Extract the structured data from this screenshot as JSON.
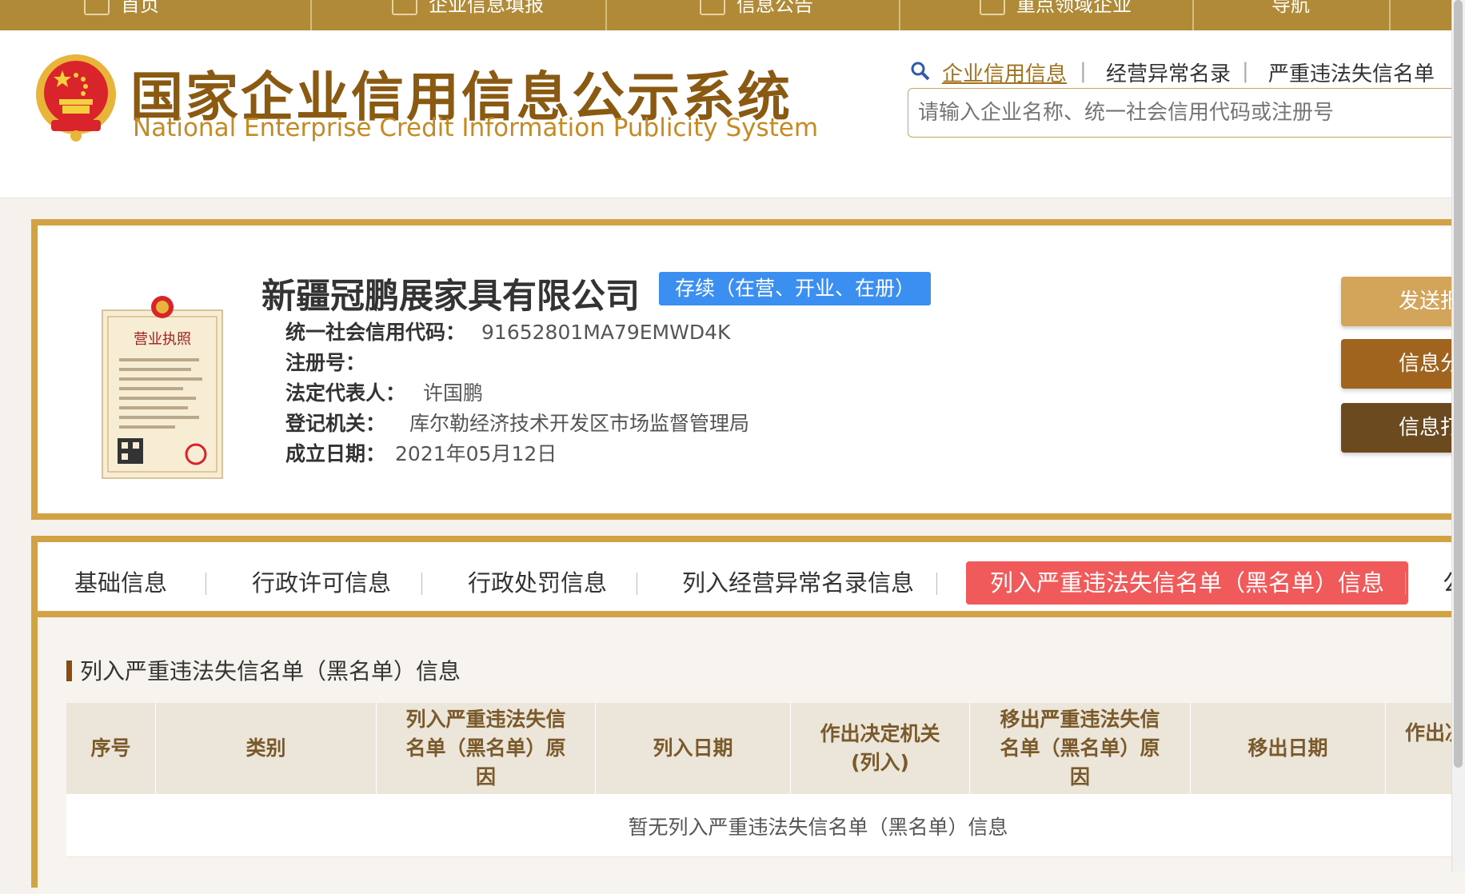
{
  "nav": {
    "items": [
      "首页",
      "企业信息填报",
      "信息公告",
      "重点领域企业",
      "导航"
    ]
  },
  "header": {
    "title_cn": "国家企业信用信息公示系统",
    "title_en": "National Enterprise Credit Information Publicity System"
  },
  "search": {
    "tabs": [
      "企业信用信息",
      "经营异常名录",
      "严重违法失信名单"
    ],
    "separator": "|",
    "placeholder": "请输入企业名称、统一社会信用代码或注册号"
  },
  "company": {
    "name": "新疆冠鹏展家具有限公司",
    "status": "存续（在营、开业、在册）",
    "fields": [
      {
        "label": "统一社会信用代码：",
        "value": "91652801MA79EMWD4K"
      },
      {
        "label": "注册号：",
        "value": ""
      },
      {
        "label": "法定代表人：",
        "value": "许国鹏"
      },
      {
        "label": "登记机关：",
        "value": "库尔勒经济技术开发区市场监督管理局"
      },
      {
        "label": "成立日期：",
        "value": "2021年05月12日"
      }
    ],
    "license_text": "营业执照"
  },
  "side_buttons": [
    {
      "label": "发送报",
      "color": "#d2a55a"
    },
    {
      "label": "信息分",
      "color": "#a0641e"
    },
    {
      "label": "信息打",
      "color": "#6a4a1e"
    }
  ],
  "tabs": {
    "items": [
      "基础信息",
      "行政许可信息",
      "行政处罚信息",
      "列入经营异常名录信息",
      "列入严重违法失信名单（黑名单）信息",
      "公"
    ],
    "active_index": 4
  },
  "section": {
    "title": "列入严重违法失信名单（黑名单）信息",
    "columns": [
      "序号",
      "类别",
      "列入严重违法失信名单（黑名单）原因",
      "列入日期",
      "作出决定机关(列入)",
      "移出严重违法失信名单（黑名单）原因",
      "移出日期",
      "作出决"
    ],
    "empty_message": "暂无列入严重违法失信名单（黑名单）信息"
  },
  "colors": {
    "nav": "#b08a36",
    "brand": "#8a5a12",
    "border": "#d2a246",
    "badge": "#3a8ff0",
    "active_tab": "#f05a5a"
  }
}
